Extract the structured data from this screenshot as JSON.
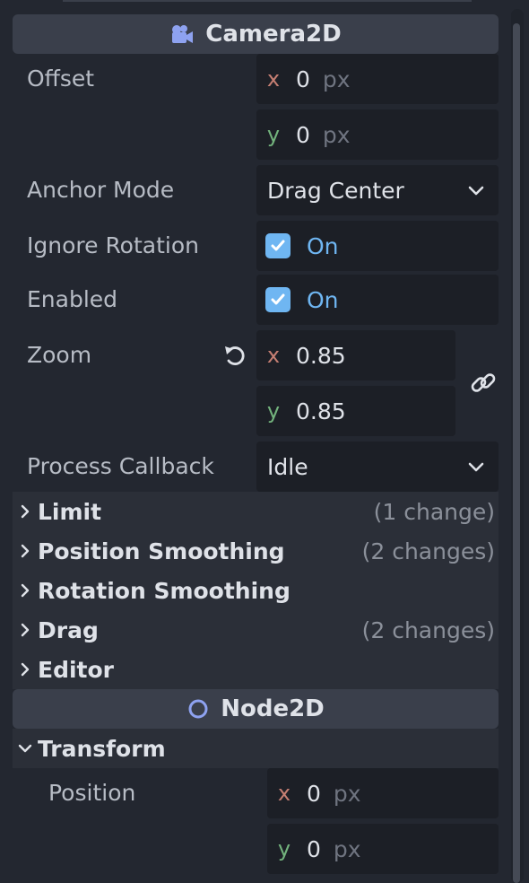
{
  "camera2d": {
    "title": "Camera2D",
    "offset": {
      "label": "Offset",
      "x_axis": "x",
      "x": "0",
      "y_axis": "y",
      "y": "0",
      "unit": "px"
    },
    "anchor_mode": {
      "label": "Anchor Mode",
      "value": "Drag Center"
    },
    "ignore_rotation": {
      "label": "Ignore Rotation",
      "checked": true,
      "state": "On"
    },
    "enabled": {
      "label": "Enabled",
      "checked": true,
      "state": "On"
    },
    "zoom": {
      "label": "Zoom",
      "x_axis": "x",
      "x": "0.85",
      "y_axis": "y",
      "y": "0.85"
    },
    "process_callback": {
      "label": "Process Callback",
      "value": "Idle"
    },
    "groups": [
      {
        "name": "Limit",
        "changes": "(1 change)"
      },
      {
        "name": "Position Smoothing",
        "changes": "(2 changes)"
      },
      {
        "name": "Rotation Smoothing",
        "changes": ""
      },
      {
        "name": "Drag",
        "changes": "(2 changes)"
      },
      {
        "name": "Editor",
        "changes": ""
      }
    ]
  },
  "node2d": {
    "title": "Node2D",
    "transform": {
      "name": "Transform",
      "position": {
        "label": "Position",
        "x_axis": "x",
        "x": "0",
        "y_axis": "y",
        "y": "0",
        "unit": "px"
      }
    }
  },
  "colors": {
    "accent": "#6fb6f2",
    "axis_x": "#c67f73",
    "axis_y": "#73b37d",
    "camera_icon": "#8ea2f0"
  },
  "icons": [
    "camera-icon",
    "reset-icon",
    "link-icon",
    "chevron-down-icon",
    "chevron-right-icon",
    "node-circle-icon",
    "checkmark-icon"
  ]
}
